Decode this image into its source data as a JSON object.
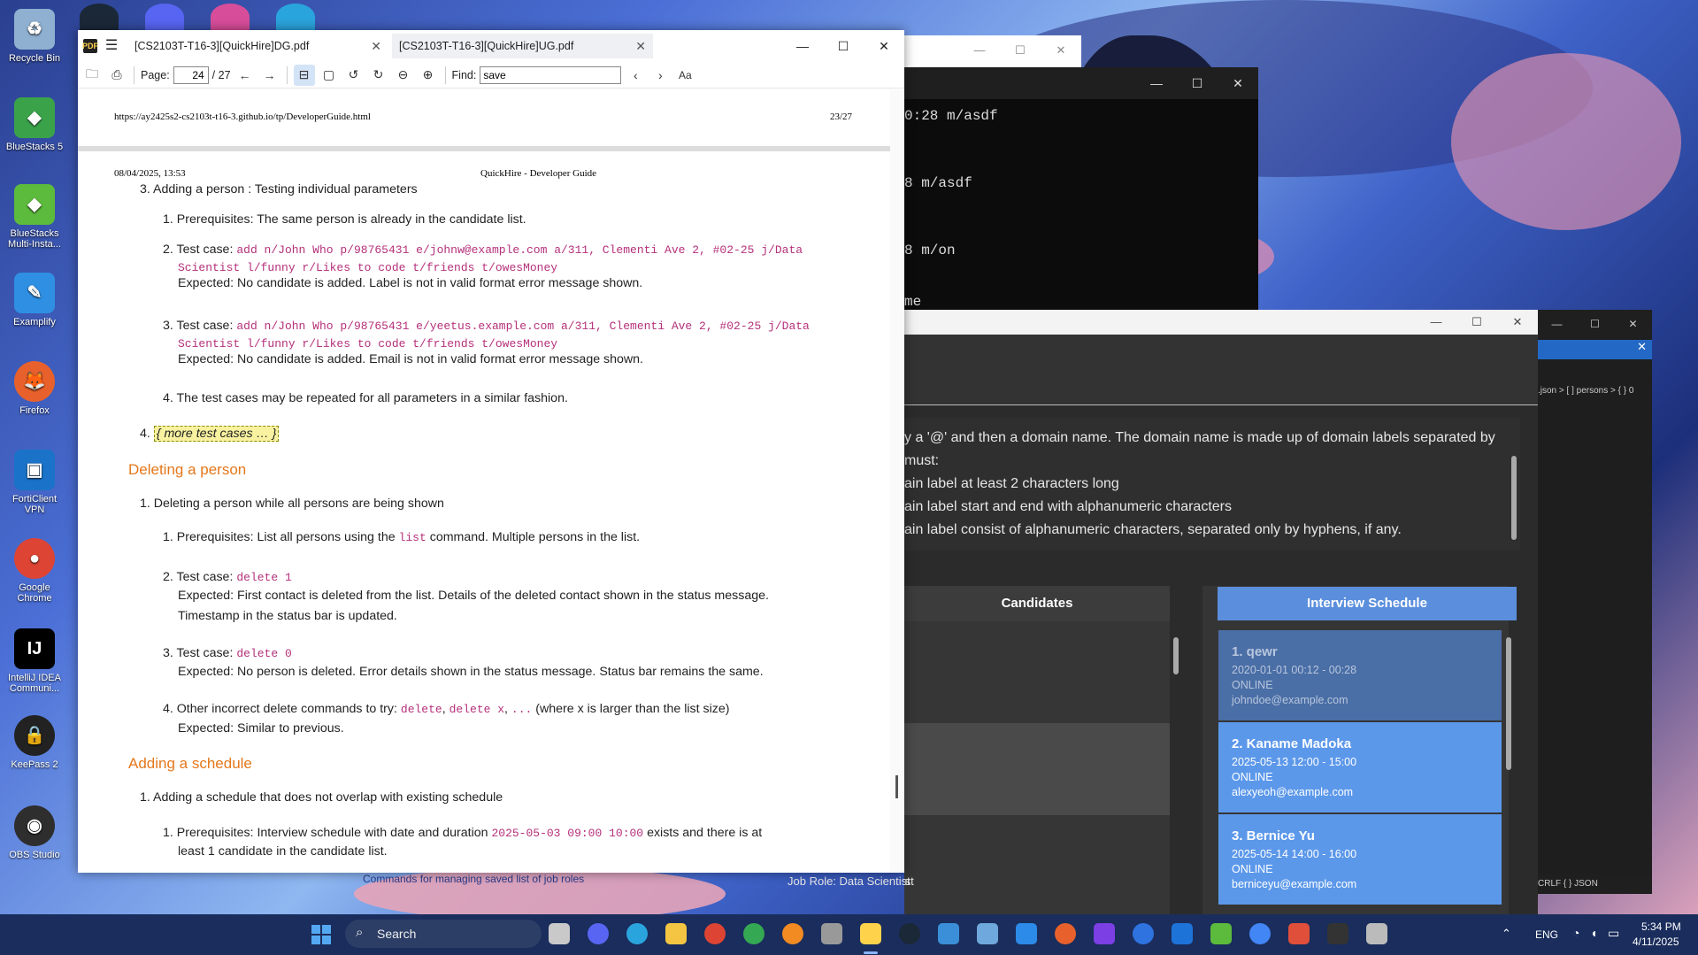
{
  "desktop": {
    "icons": [
      {
        "label": "Recycle Bin",
        "color": "#8fb0d0"
      },
      {
        "label": "BlueStacks 5",
        "color": "#3aa34a"
      },
      {
        "label": "BlueStacks Multi-Insta...",
        "color": "#5cba3c"
      },
      {
        "label": "Examplify",
        "color": "#2f8fe3"
      },
      {
        "label": "Firefox",
        "color": "#e8612c"
      },
      {
        "label": "FortiClient VPN",
        "color": "#1a73c9"
      },
      {
        "label": "Google Chrome",
        "color": "#dd4433"
      },
      {
        "label": "IntelliJ IDEA Communi...",
        "color": "#000000"
      },
      {
        "label": "KeePass 2",
        "color": "#222222"
      },
      {
        "label": "OBS Studio",
        "color": "#2e2e2e"
      }
    ]
  },
  "pdf": {
    "tabs": [
      {
        "label": "[CS2103T-T16-3][QuickHire]DG.pdf"
      },
      {
        "label": "[CS2103T-T16-3][QuickHire]UG.pdf"
      }
    ],
    "toolbar": {
      "page_label": "Page:",
      "page_value": "24",
      "page_total": "/ 27",
      "find_label": "Find:",
      "find_value": "save"
    },
    "page_a": {
      "url": "https://ay2425s2-cs2103t-t16-3.github.io/tp/DeveloperGuide.html",
      "page_num": "23/27"
    },
    "page_b": {
      "date": "08/04/2025, 13:53",
      "doc_title": "QuickHire - Developer Guide",
      "l1": "3. Adding a person : Testing individual parameters",
      "l2": "1. Prerequisites: The same person is already in the candidate list.",
      "l3a": "2. Test case:",
      "l3b": "add n/John Who p/98765431 e/johnw@example.com a/311, Clementi Ave 2, #02-25 j/Data",
      "l3c": "Scientist l/funny r/Likes to code t/friends t/owesMoney",
      "l3d": "Expected: No candidate is added. Label is not in valid format error message shown.",
      "l4a": "3. Test case:",
      "l4b": "add n/John Who p/98765431 e/yeetus.example.com a/311, Clementi Ave 2, #02-25 j/Data",
      "l4c": "Scientist l/funny r/Likes to code t/friends t/owesMoney",
      "l4d": "Expected: No candidate is added. Email is not in valid format error message shown.",
      "l5": "4. The test cases may be repeated for all parameters in a similar fashion.",
      "l6num": "4.",
      "l6": "{ more test cases … }",
      "h1": "Deleting a person",
      "d1": "1. Deleting a person while all persons are being shown",
      "d2a": "1. Prerequisites: List all persons using the",
      "d2b": "list",
      "d2c": "command. Multiple persons in the list.",
      "d3a": "2. Test case:",
      "d3b": "delete 1",
      "d3c": "Expected: First contact is deleted from the list. Details of the deleted contact shown in the status message.",
      "d3d": "Timestamp in the status bar is updated.",
      "d4a": "3. Test case:",
      "d4b": "delete 0",
      "d4c": "Expected: No person is deleted. Error details shown in the status message. Status bar remains the same.",
      "d5a": "4. Other incorrect delete commands to try:",
      "d5b": "delete",
      "d5c": "delete x",
      "d5d": "...",
      "d5e": "(where x is larger than the list size)",
      "d5f": "Expected: Similar to previous.",
      "h2": "Adding a schedule",
      "s1": "1. Adding a schedule that does not overlap with existing schedule",
      "s2a": "1. Prerequisites: Interview schedule with date and duration",
      "s2b": "2025-05-03 09:00 10:00",
      "s2c": "exists and there is at",
      "s2d": "least 1 candidate in the candidate list."
    }
  },
  "terminal": {
    "lines": [
      "0:28 m/asdf",
      "8 m/asdf",
      "8 m/on",
      "me"
    ]
  },
  "quickhire": {
    "result_lines": [
      "y a '@' and then a domain name. The domain name is made up of domain labels separated by",
      "must:",
      "ain label at least 2 characters long",
      "ain label start and end with alphanumeric characters",
      "ain label consist of alphanumeric characters, separated only by hyphens, if any."
    ],
    "candidates_header": "Candidates",
    "schedule_header": "Interview Schedule",
    "job_role": "Job Role: Data Scientist",
    "behind_text": "Commands for managing saved list of job roles",
    "schedules": [
      {
        "name": "1. qewr",
        "time": "2020-01-01  00:12 - 00:28",
        "mode": "ONLINE",
        "email": "johndoe@example.com"
      },
      {
        "name": "2. Kaname Madoka",
        "time": "2025-05-13  12:00 - 15:00",
        "mode": "ONLINE",
        "email": "alexyeoh@example.com"
      },
      {
        "name": "3. Bernice Yu",
        "time": "2025-05-14  14:00 - 16:00",
        "mode": "ONLINE",
        "email": "berniceyu@example.com"
      }
    ]
  },
  "vscode": {
    "breadcrumb": ".json > [ ] persons > { } 0",
    "status": "CRLF  { } JSON"
  },
  "taskbar": {
    "search_placeholder": "Search",
    "lang": "ENG",
    "time": "5:34 PM",
    "date": "4/11/2025"
  }
}
